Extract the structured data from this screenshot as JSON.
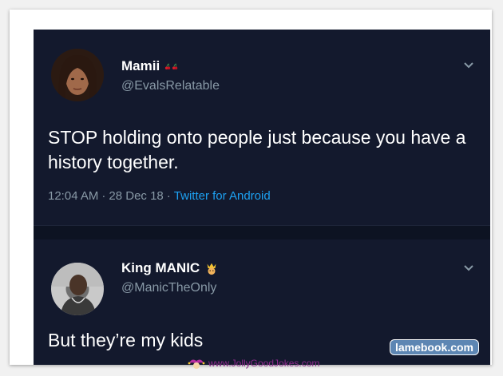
{
  "tweets": [
    {
      "display_name": "Mamii",
      "emoji": "cherries-icon",
      "handle": "@EvalsRelatable",
      "text": "STOP holding onto people just because you have a history together.",
      "time": "12:04 AM",
      "separator": "·",
      "date": "28 Dec 18",
      "source": "Twitter for Android"
    },
    {
      "display_name": "King MANIC",
      "emoji": "crowned-face-icon",
      "handle": "@ManicTheOnly",
      "text": "But they’re my kids"
    }
  ],
  "watermarks": {
    "lamebook": "lamebook.com",
    "jollygoodjokes": "www.JollyGoodJokes.com"
  },
  "colors": {
    "card_background": "#13192d",
    "secondary_text": "#8899a6",
    "link": "#1da1f2"
  }
}
